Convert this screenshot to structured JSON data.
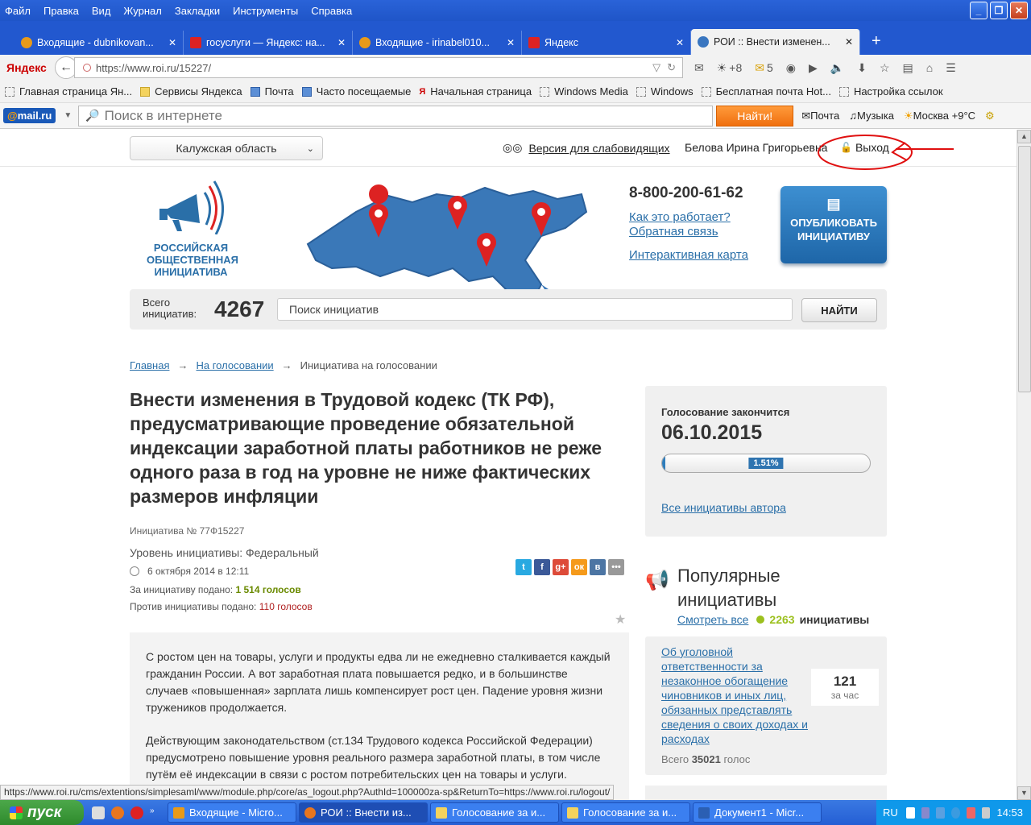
{
  "menubar": [
    "Файл",
    "Правка",
    "Вид",
    "Журнал",
    "Закладки",
    "Инструменты",
    "Справка"
  ],
  "tabs": [
    {
      "title": "Входящие - dubnikovan...",
      "color": "#e89a1a"
    },
    {
      "title": "госуслуги — Яндекс: на...",
      "color": "#d22"
    },
    {
      "title": "Входящие - irinabel010...",
      "color": "#e89a1a"
    },
    {
      "title": "Яндекс",
      "color": "#d22"
    },
    {
      "title": "РОИ :: Внести изменен...",
      "color": "#3a76c0"
    }
  ],
  "browser": {
    "brand": "Яндекс",
    "url": "https://www.roi.ru/15227/",
    "weather_count": "+8",
    "mail_count": "5"
  },
  "bookmarks": [
    "Главная страница Ян...",
    "Сервисы Яндекса",
    "Почта",
    "Часто посещаемые",
    "Начальная страница",
    "Windows Media",
    "Windows",
    "Бесплатная почта Hot...",
    "Настройка ссылок"
  ],
  "mailbar": {
    "logo_at": "@",
    "logo_text": "mail.ru",
    "search_placeholder": "Поиск в интернете",
    "find": "Найти!",
    "links": [
      "Почта",
      "Музыка",
      "Москва +9°C"
    ]
  },
  "topline": {
    "region": "Калужская область",
    "vision": "Версия для слабовидящих",
    "user": "Белова Ирина Григорьевна",
    "logout": "Выход"
  },
  "header": {
    "logo_lines": [
      "РОССИЙСКАЯ",
      "ОБЩЕСТВЕННАЯ",
      "ИНИЦИАТИВА"
    ],
    "phone": "8-800-200-61-62",
    "how": "Как это работает?",
    "feedback": "Обратная связь",
    "map": "Интерактивная карта",
    "publish_line1": "ОПУБЛИКОВАТЬ",
    "publish_line2": "ИНИЦИАТИВУ"
  },
  "search": {
    "total_label1": "Всего",
    "total_label2": "инициатив:",
    "total": "4267",
    "placeholder": "Поиск инициатив",
    "button": "НАЙТИ"
  },
  "breadcrumbs": {
    "home": "Главная",
    "voting": "На голосовании",
    "current": "Инициатива на голосовании",
    "arrow": "→"
  },
  "initiative": {
    "title": "Внести изменения в Трудовой кодекс (ТК РФ), предусматривающие проведение обязательной индексации заработной платы работников не реже одного раза в год на уровне не ниже фактических размеров инфляции",
    "number": "Инициатива № 77Ф15227",
    "level": "Уровень инициативы: Федеральный",
    "date": "6 октября 2014 в 12:11",
    "for_label": "За инициативу подано: ",
    "for_count": "1 514 голосов",
    "against_label": "Против инициативы подано: ",
    "against_count": "110 голосов",
    "paragraph1": "С ростом цен на товары, услуги и продукты едва ли не ежедневно сталкивается каждый гражданин России. А вот заработная плата повышается редко, и в большинстве случаев «повышенная» зарплата лишь компенсирует рост цен. Падение уровня жизни тружеников продолжается.",
    "paragraph2": "Действующим законодательством (ст.134 Трудового кодекса Российской Федерации) предусмотрено повышение уровня реального размера заработной платы, в том числе путём её индексации в связи с ростом потребительских цен на товары и услуги."
  },
  "vote": {
    "label": "Голосование закончится",
    "end_date": "06.10.2015",
    "progress_label": "1.51%",
    "progress_fraction": 0.0151,
    "author_link": "Все инициативы автора"
  },
  "popular": {
    "title_line1": "Популярные",
    "title_line2": "инициативы",
    "see_all": "Смотреть все",
    "count": "2263",
    "count_word": "инициативы",
    "card_link": "Об уголовной ответственности за незаконное обогащение чиновников и иных лиц, обязанных представлять сведения о своих доходах и расходах",
    "rate_value": "121",
    "rate_label": "за час",
    "total_label": "Всего ",
    "total_value": "35021",
    "total_suffix": " голос"
  },
  "status_url": "https://www.roi.ru/cms/extentions/simplesaml/www/module.php/core/as_logout.php?AuthId=100000za-sp&ReturnTo=https://www.roi.ru/logout/",
  "taskbar": {
    "start": "пуск",
    "tasks": [
      "Входящие - Micro...",
      "РОИ :: Внести из...",
      "Голосование за и...",
      "Голосование за и...",
      "Документ1 - Micr..."
    ],
    "lang": "RU",
    "time": "14:53"
  }
}
